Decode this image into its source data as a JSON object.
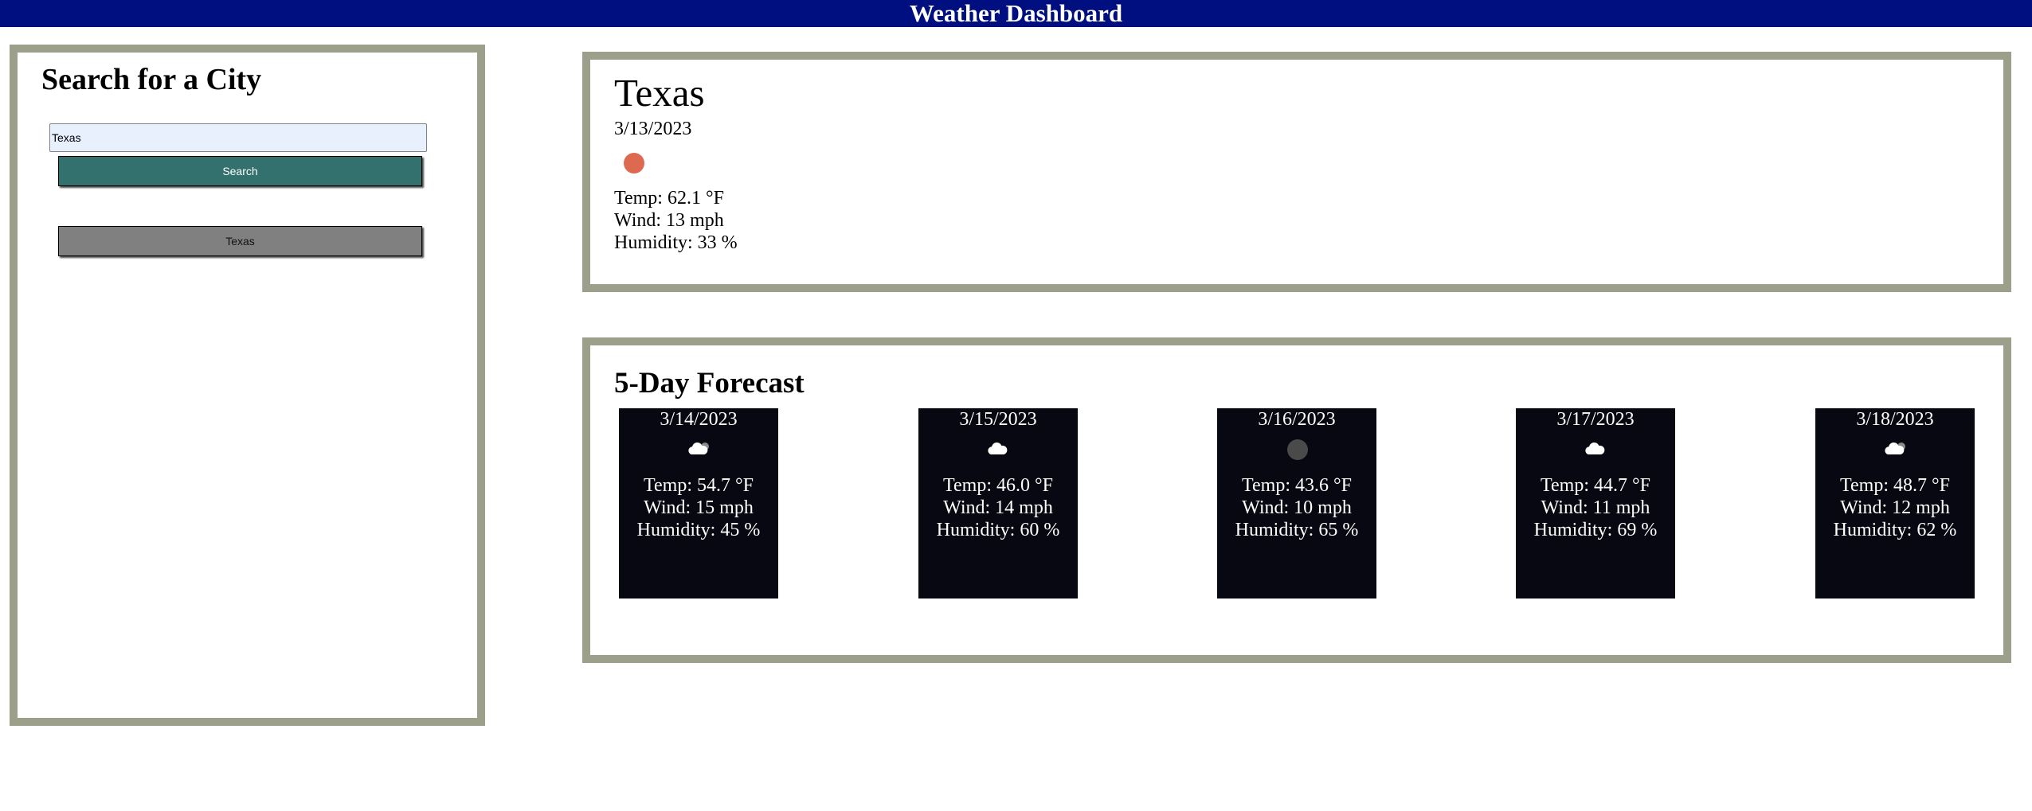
{
  "header": {
    "title": "Weather Dashboard"
  },
  "search": {
    "title": "Search for a City",
    "input_value": "Texas",
    "button_label": "Search",
    "history": [
      "Texas"
    ]
  },
  "current": {
    "city": "Texas",
    "date": "3/13/2023",
    "icon": "sun-icon",
    "icon_color": "#dd6a50",
    "temp": "Temp: 62.1 °F",
    "wind": "Wind: 13 mph",
    "humidity": "Humidity: 33 %"
  },
  "forecast": {
    "title": "5-Day Forecast",
    "days": [
      {
        "date": "3/14/2023",
        "icon": "partly-cloudy-icon",
        "temp": "Temp: 54.7 °F",
        "wind": "Wind: 15 mph",
        "humidity": "Humidity: 45 %"
      },
      {
        "date": "3/15/2023",
        "icon": "cloud-icon",
        "temp": "Temp: 46.0 °F",
        "wind": "Wind: 14 mph",
        "humidity": "Humidity: 60 %"
      },
      {
        "date": "3/16/2023",
        "icon": "overcast-icon",
        "temp": "Temp: 43.6 °F",
        "wind": "Wind: 10 mph",
        "humidity": "Humidity: 65 %"
      },
      {
        "date": "3/17/2023",
        "icon": "cloud-icon",
        "temp": "Temp: 44.7 °F",
        "wind": "Wind: 11 mph",
        "humidity": "Humidity: 69 %"
      },
      {
        "date": "3/18/2023",
        "icon": "partly-cloudy-icon",
        "temp": "Temp: 48.7 °F",
        "wind": "Wind: 12 mph",
        "humidity": "Humidity: 62 %"
      }
    ]
  },
  "colors": {
    "header_bg": "#000f80",
    "panel_border": "#9c9f8a",
    "search_button": "#32716d",
    "history_button": "#808080",
    "card_bg": "#070812"
  }
}
